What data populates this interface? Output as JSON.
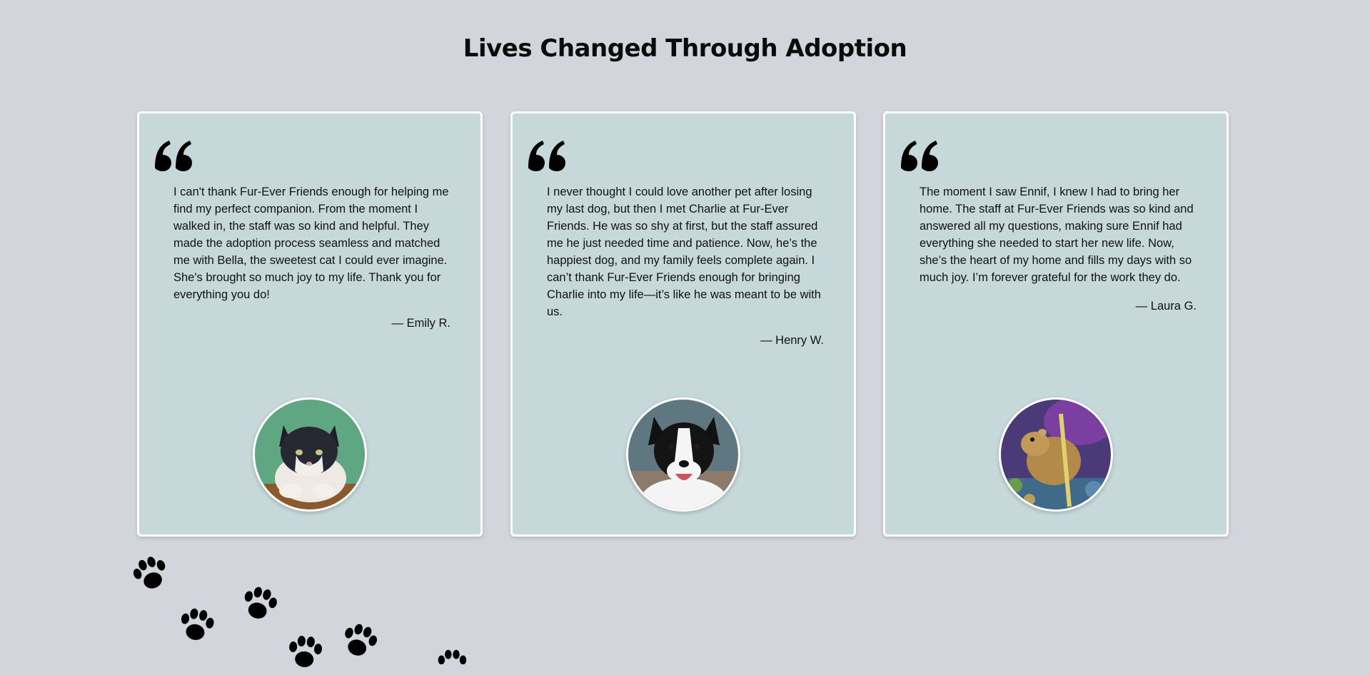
{
  "page": {
    "title": "Lives Changed Through Adoption"
  },
  "testimonials": [
    {
      "quote": "I can't thank Fur-Ever Friends enough for helping me find my perfect companion. From the moment I walked in, the staff was so kind and helpful. They made the adoption process seamless and matched me with Bella, the sweetest cat I could ever imagine. She's brought so much joy to my life. Thank you for everything you do!",
      "author": "— Emily R.",
      "pet": "cat"
    },
    {
      "quote": "I never thought I could love another pet after losing my last dog, but then I met Charlie at Fur-Ever Friends. He was so shy at first, but the staff assured me he just needed time and patience. Now, he’s the happiest dog, and my family feels complete again. I can’t thank Fur-Ever Friends enough for bringing Charlie into my life—it’s like he was meant to be with us.",
      "author": "— Henry W.",
      "pet": "dog"
    },
    {
      "quote": "The moment I saw Ennif, I knew I had to bring her home. The staff at Fur-Ever Friends was so kind and answered all my questions, making sure Ennif had everything she needed to start her new life. Now, she’s the heart of my home and fills my days with so much joy. I’m forever grateful for the work they do.",
      "author": "— Laura G.",
      "pet": "hamster"
    }
  ],
  "colors": {
    "background": "#d3d5dd",
    "card": "#c6d8da",
    "card_border": "#ffffff",
    "text": "#111111"
  },
  "icons": {
    "quote": "quote-icon",
    "paw": "paw-print-icon"
  }
}
